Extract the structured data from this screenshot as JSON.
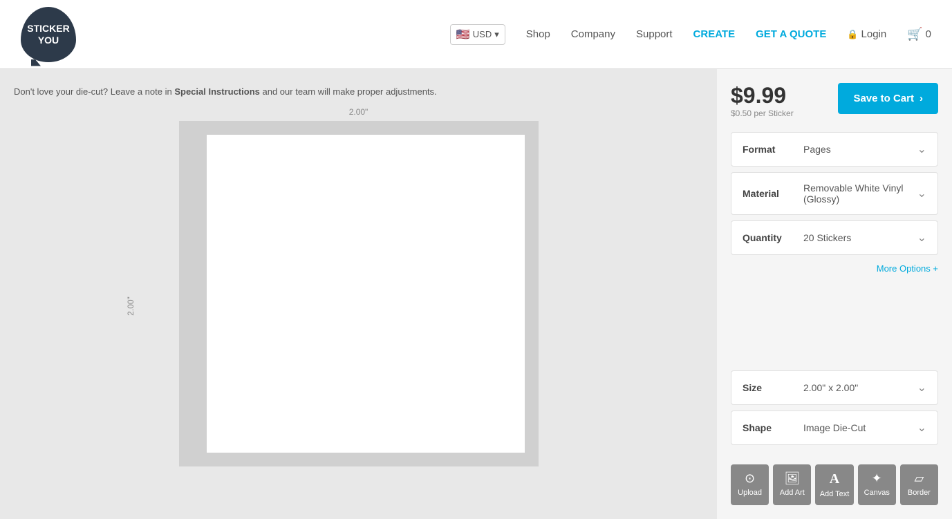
{
  "header": {
    "currency": "USD",
    "flag": "🇺🇸",
    "nav": {
      "shop": "Shop",
      "company": "Company",
      "support": "Support",
      "create": "CREATE",
      "getQuote": "GET A QUOTE",
      "login": "Login",
      "cartCount": "0"
    },
    "logo_line1": "STICKER",
    "logo_line2": "YOU"
  },
  "info_bar": {
    "text_before": "Don't love your die-cut?",
    "text_middle": " Leave a note in ",
    "highlight": "Special Instructions",
    "text_after": " and our team will make proper adjustments."
  },
  "canvas": {
    "dimension_top": "2.00\"",
    "dimension_left": "2.00\""
  },
  "pricing": {
    "price": "$9.99",
    "per_sticker": "$0.50 per Sticker",
    "save_button": "Save to Cart"
  },
  "dropdowns": [
    {
      "label": "Format",
      "value": "Pages"
    },
    {
      "label": "Material",
      "value": "Removable White Vinyl (Glossy)"
    },
    {
      "label": "Quantity",
      "value": "20 Stickers"
    },
    {
      "label": "Size",
      "value": "2.00\" x 2.00\""
    },
    {
      "label": "Shape",
      "value": "Image Die-Cut"
    }
  ],
  "more_options": "More Options +",
  "tools": [
    {
      "label": "Upload",
      "icon": "⊙"
    },
    {
      "label": "Add Art",
      "icon": "🖼"
    },
    {
      "label": "Add Text",
      "icon": "A"
    },
    {
      "label": "Canvas",
      "icon": "✦"
    },
    {
      "label": "Border",
      "icon": "▱"
    }
  ]
}
